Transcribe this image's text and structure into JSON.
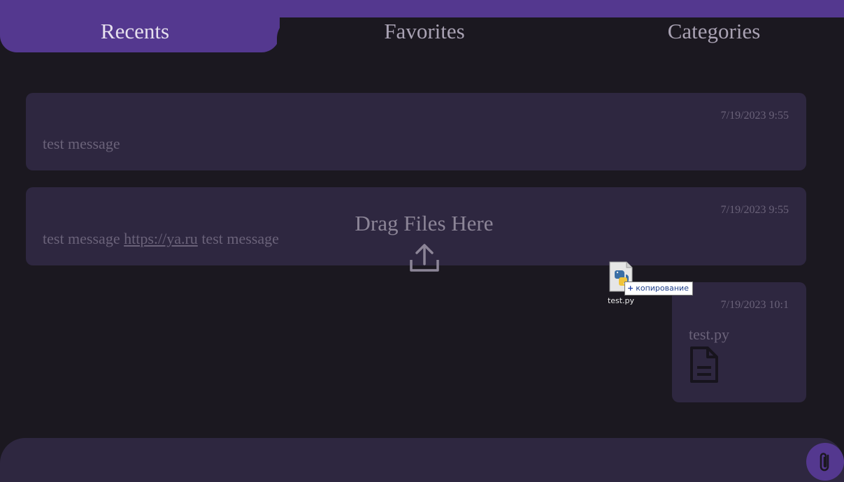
{
  "tabs": [
    {
      "label": "Recents"
    },
    {
      "label": "Favorites"
    },
    {
      "label": "Categories"
    }
  ],
  "messages": [
    {
      "time": "7/19/2023 9:55",
      "text": "test message"
    },
    {
      "time": "7/19/2023 9:55",
      "text_before": "test message ",
      "link": "https://ya.ru",
      "text_after": " test message"
    },
    {
      "time": "7/19/2023 10:1",
      "filename": "test.py",
      "icon": "file-document-icon"
    }
  ],
  "drop_zone": {
    "title": "Drag Files Here",
    "icon": "upload-icon"
  },
  "drag_ghost": {
    "filename": "test.py",
    "action": "копирование",
    "icon": "python-file-icon"
  },
  "composer": {
    "attach_icon": "paperclip-icon"
  },
  "colors": {
    "accent": "#54388f",
    "background": "#1b1820",
    "card": "#2e2740",
    "muted_text": "#6a6279"
  }
}
